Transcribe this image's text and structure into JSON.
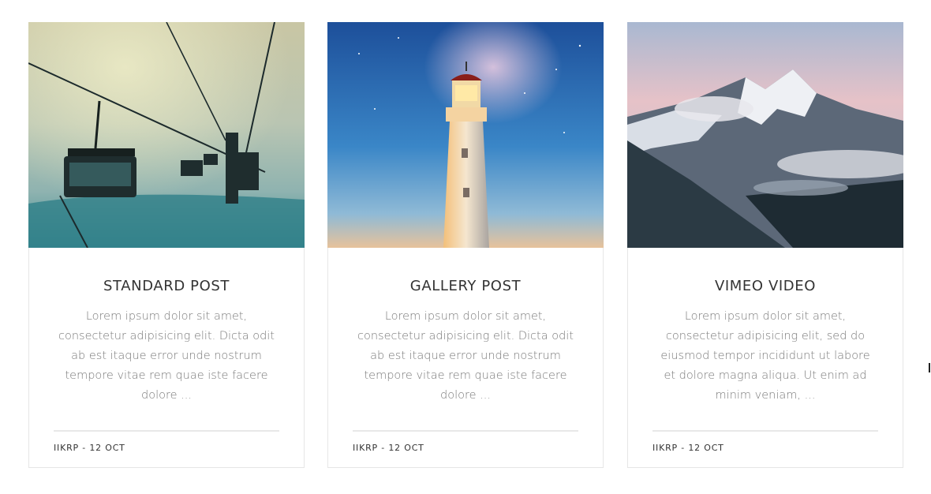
{
  "posts": [
    {
      "title": "STANDARD POST",
      "excerpt": "Lorem ipsum dolor sit amet, consectetur adipisicing elit. Dicta odit ab est itaque error unde nostrum tempore vitae rem quae iste facere dolore ...",
      "meta": "IIKRP - 12 OCT",
      "image": "ski-lift-chairs-in-fog"
    },
    {
      "title": "GALLERY POST",
      "excerpt": "Lorem ipsum dolor sit amet, consectetur adipisicing elit. Dicta odit ab est itaque error unde nostrum tempore vitae rem quae iste facere dolore ...",
      "meta": "IIKRP - 12 OCT",
      "image": "lighthouse-under-night-sky"
    },
    {
      "title": "VIMEO VIDEO",
      "excerpt": "Lorem ipsum dolor sit amet, consectetur adipisicing elit, sed do eiusmod tempor incididunt ut labore et dolore magna aliqua. Ut enim ad minim veniam, ...",
      "meta": "IIKRP - 12 OCT",
      "image": "snowy-mountain-peak"
    }
  ],
  "colors": {
    "title": "#333333",
    "excerpt": "#7a7a7a",
    "border": "#e6e6e6",
    "divider": "#e8e8e8"
  }
}
